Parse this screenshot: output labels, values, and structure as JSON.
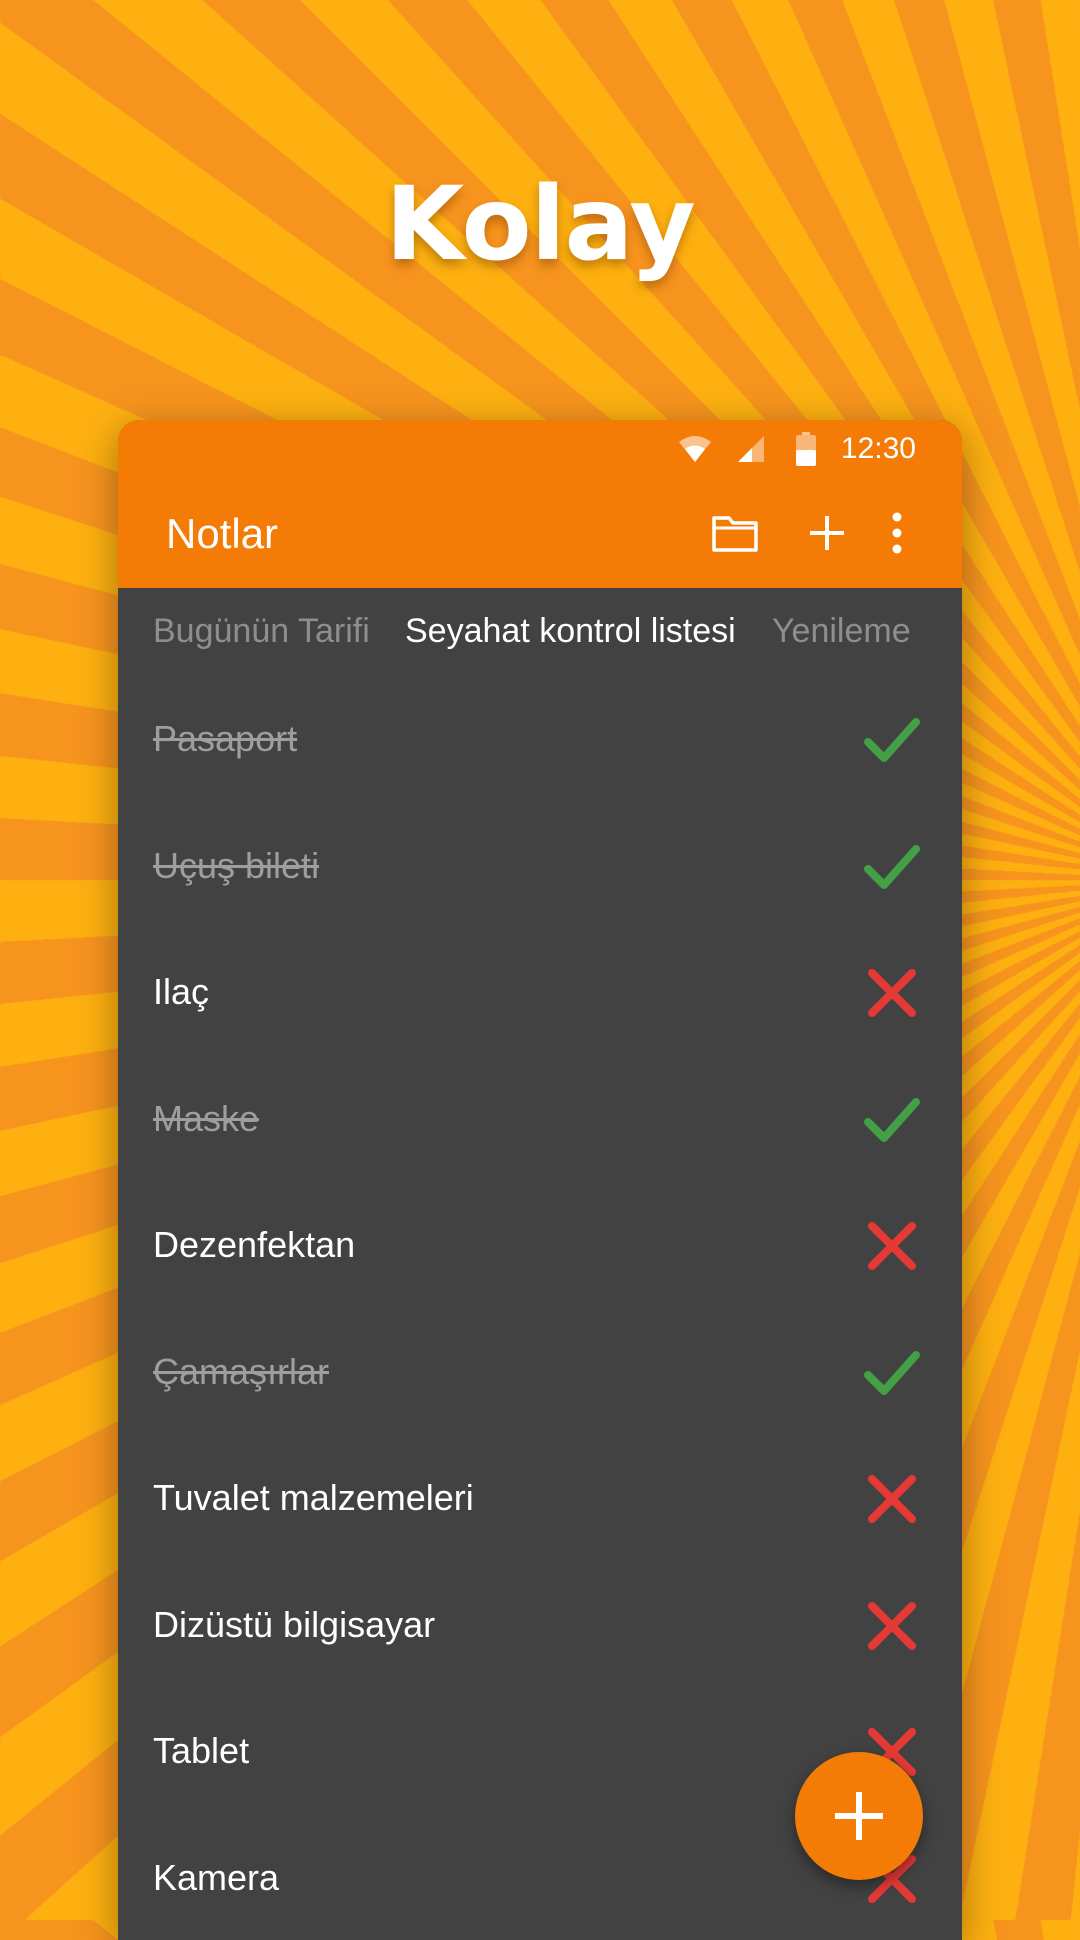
{
  "promo": {
    "headline": "Kolay"
  },
  "status_bar": {
    "time": "12:30",
    "icons": [
      "wifi-icon",
      "signal-icon",
      "battery-icon"
    ]
  },
  "app_bar": {
    "title": "Notlar",
    "actions": [
      "folder-icon",
      "plus-icon",
      "more-vert-icon"
    ]
  },
  "tabs": [
    {
      "label": "Bugünün Tarifi",
      "active": false
    },
    {
      "label": "Seyahat kontrol listesi",
      "active": true
    },
    {
      "label": "Yenileme",
      "active": false
    }
  ],
  "checklist": [
    {
      "label": "Pasaport",
      "checked": true
    },
    {
      "label": "Uçuş bileti",
      "checked": true
    },
    {
      "label": "Ilaç",
      "checked": false
    },
    {
      "label": "Maske",
      "checked": true
    },
    {
      "label": "Dezenfektan",
      "checked": false
    },
    {
      "label": "Çamaşırlar",
      "checked": true
    },
    {
      "label": "Tuvalet malzemeleri",
      "checked": false
    },
    {
      "label": "Dizüstü bilgisayar",
      "checked": false
    },
    {
      "label": "Tablet",
      "checked": false
    },
    {
      "label": "Kamera",
      "checked": false
    }
  ],
  "fab": {
    "icon": "plus-icon"
  },
  "colors": {
    "accent": "#f47b06",
    "list_background": "#424242",
    "check_green": "#43a047",
    "cross_red": "#e53935"
  }
}
